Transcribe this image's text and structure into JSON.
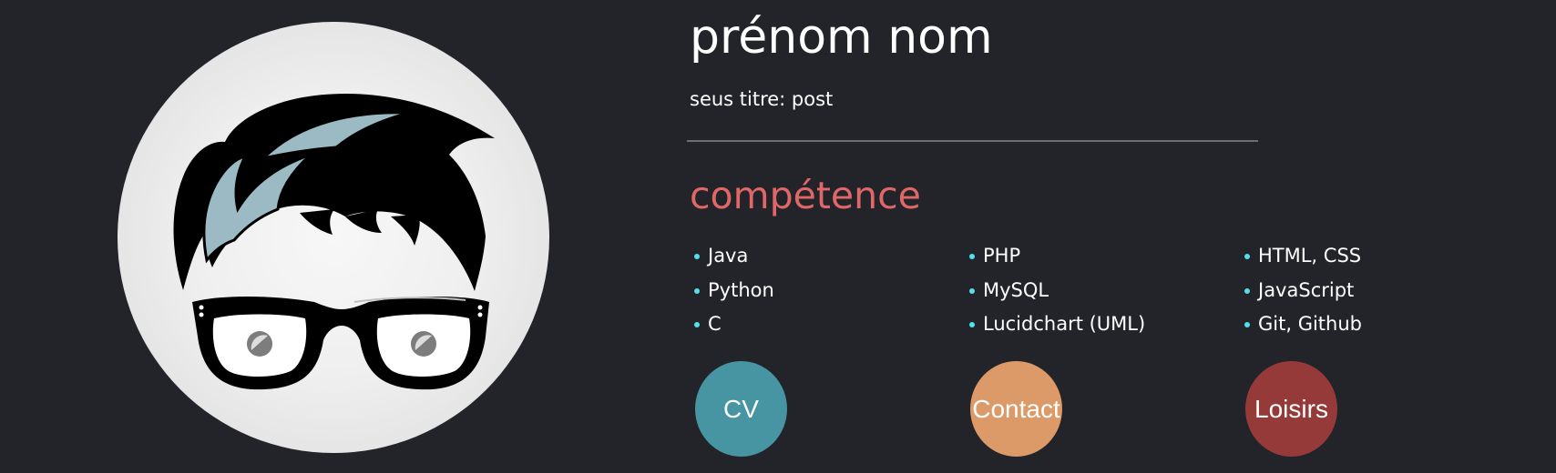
{
  "profile": {
    "name": "prénom nom",
    "subtitle": "seus titre: post"
  },
  "skills": {
    "title": "compétence",
    "title_color": "#e06767",
    "bullet_color": "#54e0ea",
    "columns": [
      [
        "Java",
        "Python",
        "C"
      ],
      [
        "PHP",
        "MySQL",
        " Lucidchart (UML)"
      ],
      [
        "HTML, CSS",
        "JavaScript",
        "Git, Github"
      ]
    ]
  },
  "buttons": {
    "cv": {
      "label": "CV",
      "color": "#4795a3"
    },
    "contact": {
      "label": "Contact",
      "color": "#dc9a68"
    },
    "loisirs": {
      "label": "Loisirs",
      "color": "#963a39"
    }
  },
  "avatar": {
    "icon": "nerd-avatar-icon",
    "hair_accent_color": "#9bbac4"
  }
}
